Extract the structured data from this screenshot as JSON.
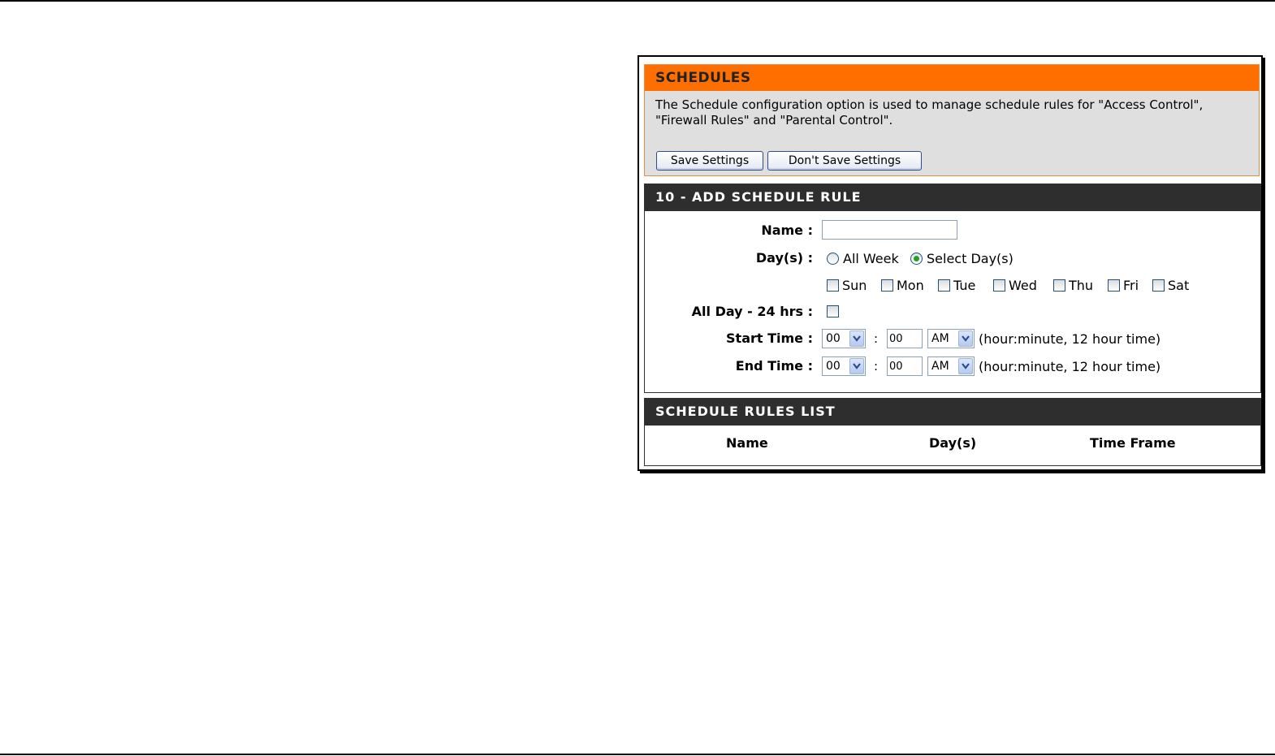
{
  "schedules": {
    "title": "SCHEDULES",
    "description_line1": "The Schedule configuration option is used to manage schedule rules for \"Access Control\",",
    "description_line2": "\"Firewall Rules\" and \"Parental Control\".",
    "save_label": "Save Settings",
    "dont_save_label": "Don't Save Settings"
  },
  "add_rule": {
    "title": "10 - ADD SCHEDULE RULE",
    "name_label": "Name :",
    "name_value": "",
    "days_label": "Day(s) :",
    "days_options": [
      "All Week",
      "Select Day(s)"
    ],
    "days_selected": "Select Day(s)",
    "weekdays": [
      "Sun",
      "Mon",
      "Tue",
      "Wed",
      "Thu",
      "Fri",
      "Sat"
    ],
    "allday_label": "All Day - 24 hrs :",
    "start_label": "Start Time :",
    "end_label": "End Time :",
    "start_hour": "00",
    "start_minute": "00",
    "start_ampm": "AM",
    "end_hour": "00",
    "end_minute": "00",
    "end_ampm": "AM",
    "colon": ":",
    "time_hint": "(hour:minute, 12 hour time)"
  },
  "rules_list": {
    "title": "SCHEDULE RULES LIST",
    "columns": [
      "Name",
      "Day(s)",
      "Time Frame"
    ]
  }
}
